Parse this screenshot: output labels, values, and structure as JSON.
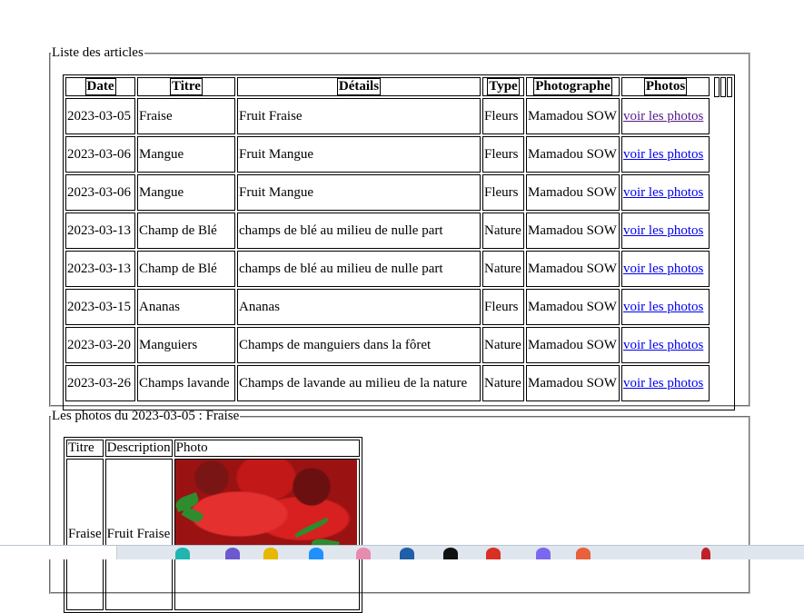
{
  "articles": {
    "legend": "Liste des articles",
    "headers": [
      "Date",
      "Titre",
      "Détails",
      "Type",
      "Photographe",
      "Photos"
    ],
    "rows": [
      {
        "date": "2023-03-05",
        "titre": "Fraise",
        "details": "Fruit Fraise",
        "type": "Fleurs",
        "photographe": "Mamadou SOW",
        "link": "voir les photos"
      },
      {
        "date": "2023-03-06",
        "titre": "Mangue",
        "details": "Fruit Mangue",
        "type": "Fleurs",
        "photographe": "Mamadou SOW",
        "link": "voir les photos"
      },
      {
        "date": "2023-03-06",
        "titre": "Mangue",
        "details": "Fruit Mangue",
        "type": "Fleurs",
        "photographe": "Mamadou SOW",
        "link": "voir les photos"
      },
      {
        "date": "2023-03-13",
        "titre": "Champ de Blé",
        "details": "champs de blé au milieu de nulle part",
        "type": "Nature",
        "photographe": "Mamadou SOW",
        "link": "voir les photos"
      },
      {
        "date": "2023-03-13",
        "titre": "Champ de Blé",
        "details": "champs de blé au milieu de nulle part",
        "type": "Nature",
        "photographe": "Mamadou SOW",
        "link": "voir les photos"
      },
      {
        "date": "2023-03-15",
        "titre": "Ananas",
        "details": "Ananas",
        "type": "Fleurs",
        "photographe": "Mamadou SOW",
        "link": "voir les photos"
      },
      {
        "date": "2023-03-20",
        "titre": "Manguiers",
        "details": "Champs de manguiers dans la fôret",
        "type": "Nature",
        "photographe": "Mamadou SOW",
        "link": "voir les photos"
      },
      {
        "date": "2023-03-26",
        "titre": "Champs lavande",
        "details": "Champs de lavande au milieu de la nature",
        "type": "Nature",
        "photographe": "Mamadou SOW",
        "link": "voir les photos"
      }
    ]
  },
  "photos": {
    "legend": "Les photos du 2023-03-05 : Fraise",
    "headers": [
      "Titre",
      "Description",
      "Photo"
    ],
    "row": {
      "titre": "Fraise",
      "description": "Fruit Fraise",
      "photo_subject": "strawberries"
    }
  }
}
